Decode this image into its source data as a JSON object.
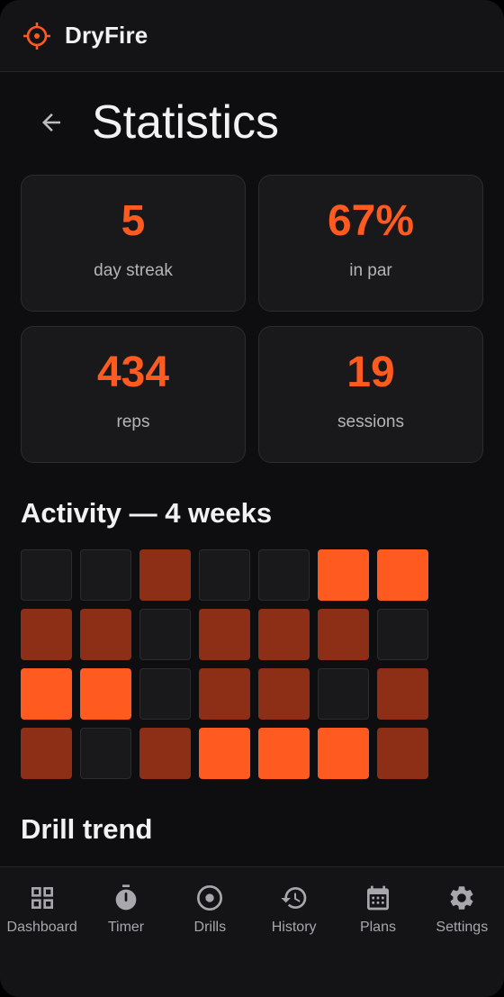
{
  "app": {
    "name": "DryFire",
    "accent": "#ff5a1f"
  },
  "header": {
    "title": "Statistics"
  },
  "stats": [
    {
      "value": "5",
      "label": "day streak"
    },
    {
      "value": "67%",
      "label": "in par"
    },
    {
      "value": "434",
      "label": "reps"
    },
    {
      "value": "19",
      "label": "sessions"
    }
  ],
  "activity": {
    "title": "Activity — 4 weeks",
    "levels": [
      [
        0,
        0,
        1,
        0,
        0,
        2,
        2
      ],
      [
        1,
        1,
        0,
        1,
        1,
        1,
        0
      ],
      [
        2,
        2,
        0,
        1,
        1,
        0,
        1
      ],
      [
        1,
        0,
        1,
        2,
        2,
        2,
        1
      ]
    ]
  },
  "trend": {
    "title": "Drill trend"
  },
  "nav": [
    {
      "label": "Dashboard",
      "icon": "dashboard-icon"
    },
    {
      "label": "Timer",
      "icon": "timer-icon"
    },
    {
      "label": "Drills",
      "icon": "drills-icon"
    },
    {
      "label": "History",
      "icon": "history-icon"
    },
    {
      "label": "Plans",
      "icon": "calendar-icon"
    },
    {
      "label": "Settings",
      "icon": "gear-icon"
    }
  ]
}
